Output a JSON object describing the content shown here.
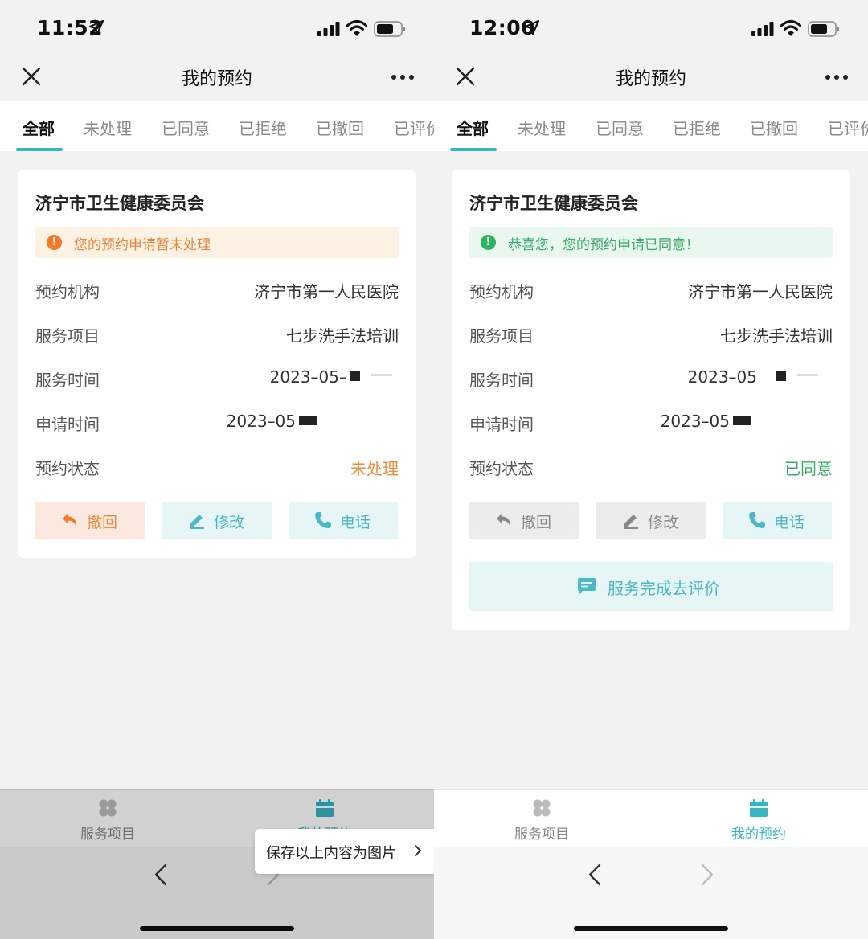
{
  "colors": {
    "accent": "#36b5c2",
    "pending": "#f08a38",
    "approved": "#36ac65"
  },
  "left": {
    "status": {
      "time": "11:52"
    },
    "nav": {
      "title": "我的预约"
    },
    "tabs": [
      "全部",
      "未处理",
      "已同意",
      "已拒绝",
      "已撤回",
      "已评价"
    ],
    "card": {
      "org": "济宁市卫生健康委员会",
      "notice": "您的预约申请暂未处理",
      "rows": [
        {
          "label": "预约机构",
          "value": "济宁市第一人民医院"
        },
        {
          "label": "服务项目",
          "value": "七步洗手法培训"
        },
        {
          "label": "服务时间",
          "value": "2023–05–"
        },
        {
          "label": "申请时间",
          "value": "2023–05"
        },
        {
          "label": "预约状态",
          "value": "未处理"
        }
      ],
      "buttons": {
        "revoke": "撤回",
        "edit": "修改",
        "phone": "电话"
      }
    },
    "bottom_tabs": {
      "services": "服务项目",
      "mine": "我的预约"
    },
    "save_popup": "保存以上内容为图片"
  },
  "right": {
    "status": {
      "time": "12:00"
    },
    "nav": {
      "title": "我的预约"
    },
    "tabs": [
      "全部",
      "未处理",
      "已同意",
      "已拒绝",
      "已撤回",
      "已评价"
    ],
    "card": {
      "org": "济宁市卫生健康委员会",
      "notice": "恭喜您，您的预约申请已同意！",
      "rows": [
        {
          "label": "预约机构",
          "value": "济宁市第一人民医院"
        },
        {
          "label": "服务项目",
          "value": "七步洗手法培训"
        },
        {
          "label": "服务时间",
          "value": "2023–05"
        },
        {
          "label": "申请时间",
          "value": "2023–05"
        },
        {
          "label": "预约状态",
          "value": "已同意"
        }
      ],
      "buttons": {
        "revoke": "撤回",
        "edit": "修改",
        "phone": "电话"
      },
      "review": "服务完成去评价"
    },
    "bottom_tabs": {
      "services": "服务项目",
      "mine": "我的预约"
    }
  }
}
